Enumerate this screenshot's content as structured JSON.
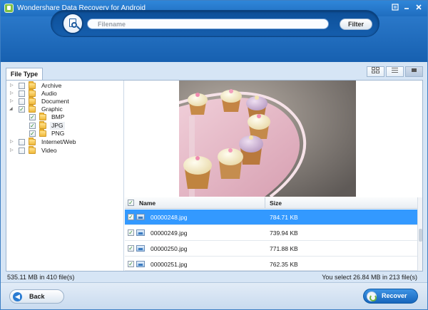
{
  "window": {
    "title": "Wondershare Data Recovery for Android",
    "controls": [
      "settings-icon",
      "minimize-icon",
      "close-icon"
    ]
  },
  "search": {
    "placeholder": "Filename",
    "value": "",
    "filter_label": "Filter"
  },
  "tabs": {
    "file_type": "File Type"
  },
  "view_modes": [
    "thumbnail-view-icon",
    "list-view-icon",
    "detail-view-icon"
  ],
  "tree": {
    "items": [
      {
        "label": "Archive",
        "checked": false,
        "expanded": false
      },
      {
        "label": "Audio",
        "checked": false,
        "expanded": false
      },
      {
        "label": "Document",
        "checked": false,
        "expanded": false
      },
      {
        "label": "Graphic",
        "checked": true,
        "expanded": true
      },
      {
        "label": "BMP",
        "checked": true,
        "child": true
      },
      {
        "label": "JPG",
        "checked": true,
        "child": true,
        "selected": true
      },
      {
        "label": "PNG",
        "checked": true,
        "child": true
      },
      {
        "label": "Internet/Web",
        "checked": false,
        "expanded": false
      },
      {
        "label": "Video",
        "checked": false,
        "expanded": false
      }
    ]
  },
  "table": {
    "headers": {
      "name": "Name",
      "size": "Size"
    },
    "rows": [
      {
        "name": "00000248.jpg",
        "size": "784.71 KB",
        "checked": true,
        "selected": true
      },
      {
        "name": "00000249.jpg",
        "size": "739.94 KB",
        "checked": true,
        "selected": false
      },
      {
        "name": "00000250.jpg",
        "size": "771.88 KB",
        "checked": true,
        "selected": false
      },
      {
        "name": "00000251.jpg",
        "size": "762.35 KB",
        "checked": true,
        "selected": false
      }
    ]
  },
  "status": {
    "left": "535.11 MB in 410 file(s)",
    "right": "You select 26.84 MB in 213 file(s)"
  },
  "buttons": {
    "back": "Back",
    "recover": "Recover"
  }
}
